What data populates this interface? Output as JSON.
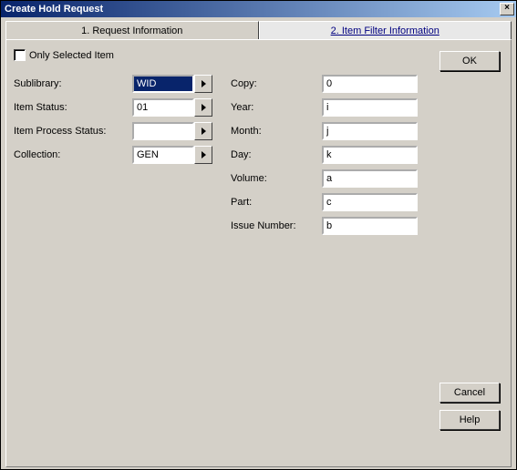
{
  "window": {
    "title": "Create Hold Request"
  },
  "tabs": {
    "t1": "1. Request Information",
    "t2": "2. Item Filter Information"
  },
  "checkbox": {
    "label": "Only Selected Item"
  },
  "left": {
    "sublibrary": {
      "label": "Sublibrary:",
      "value": "WID"
    },
    "itemstatus": {
      "label": "Item Status:",
      "value": "01"
    },
    "itemprocess": {
      "label": "Item Process Status:",
      "value": ""
    },
    "collection": {
      "label": "Collection:",
      "value": "GEN"
    }
  },
  "mid": {
    "copy": {
      "label": "Copy:",
      "value": "0"
    },
    "year": {
      "label": "Year:",
      "value": "i"
    },
    "month": {
      "label": "Month:",
      "value": "j"
    },
    "day": {
      "label": "Day:",
      "value": "k"
    },
    "volume": {
      "label": "Volume:",
      "value": "a"
    },
    "part": {
      "label": "Part:",
      "value": "c"
    },
    "issue": {
      "label": "Issue Number:",
      "value": "b"
    }
  },
  "buttons": {
    "ok": "OK",
    "cancel": "Cancel",
    "help": "Help"
  }
}
